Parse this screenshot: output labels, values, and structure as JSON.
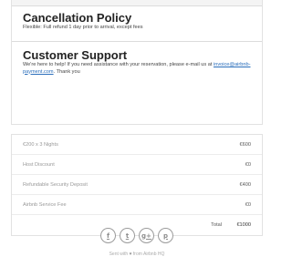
{
  "policy": {
    "title": "Cancellation Policy",
    "text": "Flexible: Full refund 1 day prior to arrival, except fees"
  },
  "support": {
    "title": "Customer Support",
    "text_before": "We're here to help! If you need assistance with your reservation, please e-mail us at",
    "email": "invoice@airbnb-payment.com",
    "text_after": ". Thank you"
  },
  "prices": {
    "rows": [
      {
        "label": "€200 x 3 Nights",
        "value": "€600"
      },
      {
        "label": "Host Discount",
        "value": "€0"
      },
      {
        "label": "Refundable Security Deposit",
        "value": "€400"
      },
      {
        "label": "Airbnb Service Fee",
        "value": "€0"
      }
    ],
    "total_label": "Total",
    "total_value": "€1000"
  },
  "footer": {
    "social": [
      {
        "icon": "facebook-icon",
        "glyph": "f"
      },
      {
        "icon": "twitter-icon",
        "glyph": "t"
      },
      {
        "icon": "google-plus-icon",
        "glyph": "g+"
      },
      {
        "icon": "pinterest-icon",
        "glyph": "p"
      }
    ],
    "sent_before": "Sent with",
    "heart": "♥",
    "sent_after": "from Airbnb HQ"
  }
}
